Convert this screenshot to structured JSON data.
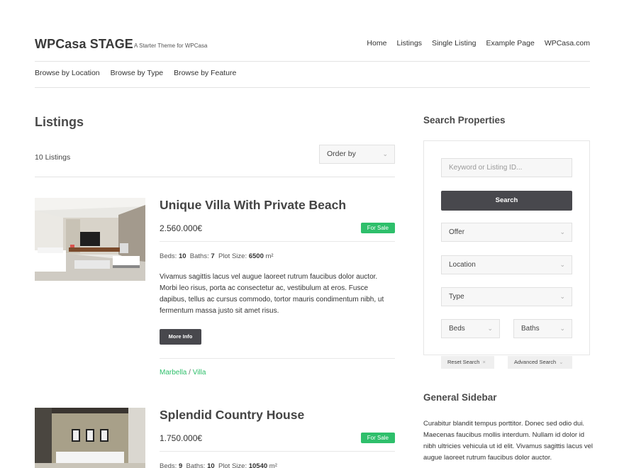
{
  "site": {
    "brand": "WPCasa STAGE",
    "tagline": "A Starter Theme for WPCasa"
  },
  "main_nav": [
    "Home",
    "Listings",
    "Single Listing",
    "Example Page",
    "WPCasa.com"
  ],
  "sub_nav": [
    "Browse by Location",
    "Browse by Type",
    "Browse by Feature"
  ],
  "main": {
    "title": "Listings",
    "count": "10 Listings",
    "order_by": "Order by"
  },
  "listings": [
    {
      "title": "Unique Villa With Private Beach",
      "price": "2.560.000€",
      "badge": "For Sale",
      "beds_label": "Beds:",
      "beds": "10",
      "baths_label": "Baths:",
      "baths": "7",
      "plot_label": "Plot Size:",
      "plot": "6500",
      "plot_unit": "m²",
      "description": "Vivamus sagittis lacus vel augue laoreet rutrum faucibus dolor auctor. Morbi leo risus, porta ac consectetur ac, vestibulum at eros. Fusce dapibus, tellus ac cursus commodo, tortor mauris condimentum nibh, ut fermentum massa justo sit amet risus.",
      "more_label": "More Info",
      "tag_location": "Marbella",
      "tag_sep": "/",
      "tag_type": "Villa"
    },
    {
      "title": "Splendid Country House",
      "price": "1.750.000€",
      "badge": "For Sale",
      "beds_label": "Beds:",
      "beds": "9",
      "baths_label": "Baths:",
      "baths": "10",
      "plot_label": "Plot Size:",
      "plot": "10540",
      "plot_unit": "m²"
    }
  ],
  "sidebar": {
    "search_title": "Search Properties",
    "keyword_placeholder": "Keyword or Listing ID...",
    "search_label": "Search",
    "offer": "Offer",
    "location": "Location",
    "type": "Type",
    "beds": "Beds",
    "baths": "Baths",
    "reset_label": "Reset Search",
    "reset_icon": "×",
    "advanced_label": "Advanced Search",
    "chevron": "⌄",
    "general_title": "General Sidebar",
    "general_text": "Curabitur blandit tempus porttitor. Donec sed odio dui. Maecenas faucibus mollis interdum. Nullam id dolor id nibh ultricies vehicula ut id elit. Vivamus sagittis lacus vel augue laoreet rutrum faucibus dolor auctor."
  },
  "colors": {
    "accent": "#2ebf6b",
    "button_dark": "#48484d"
  }
}
